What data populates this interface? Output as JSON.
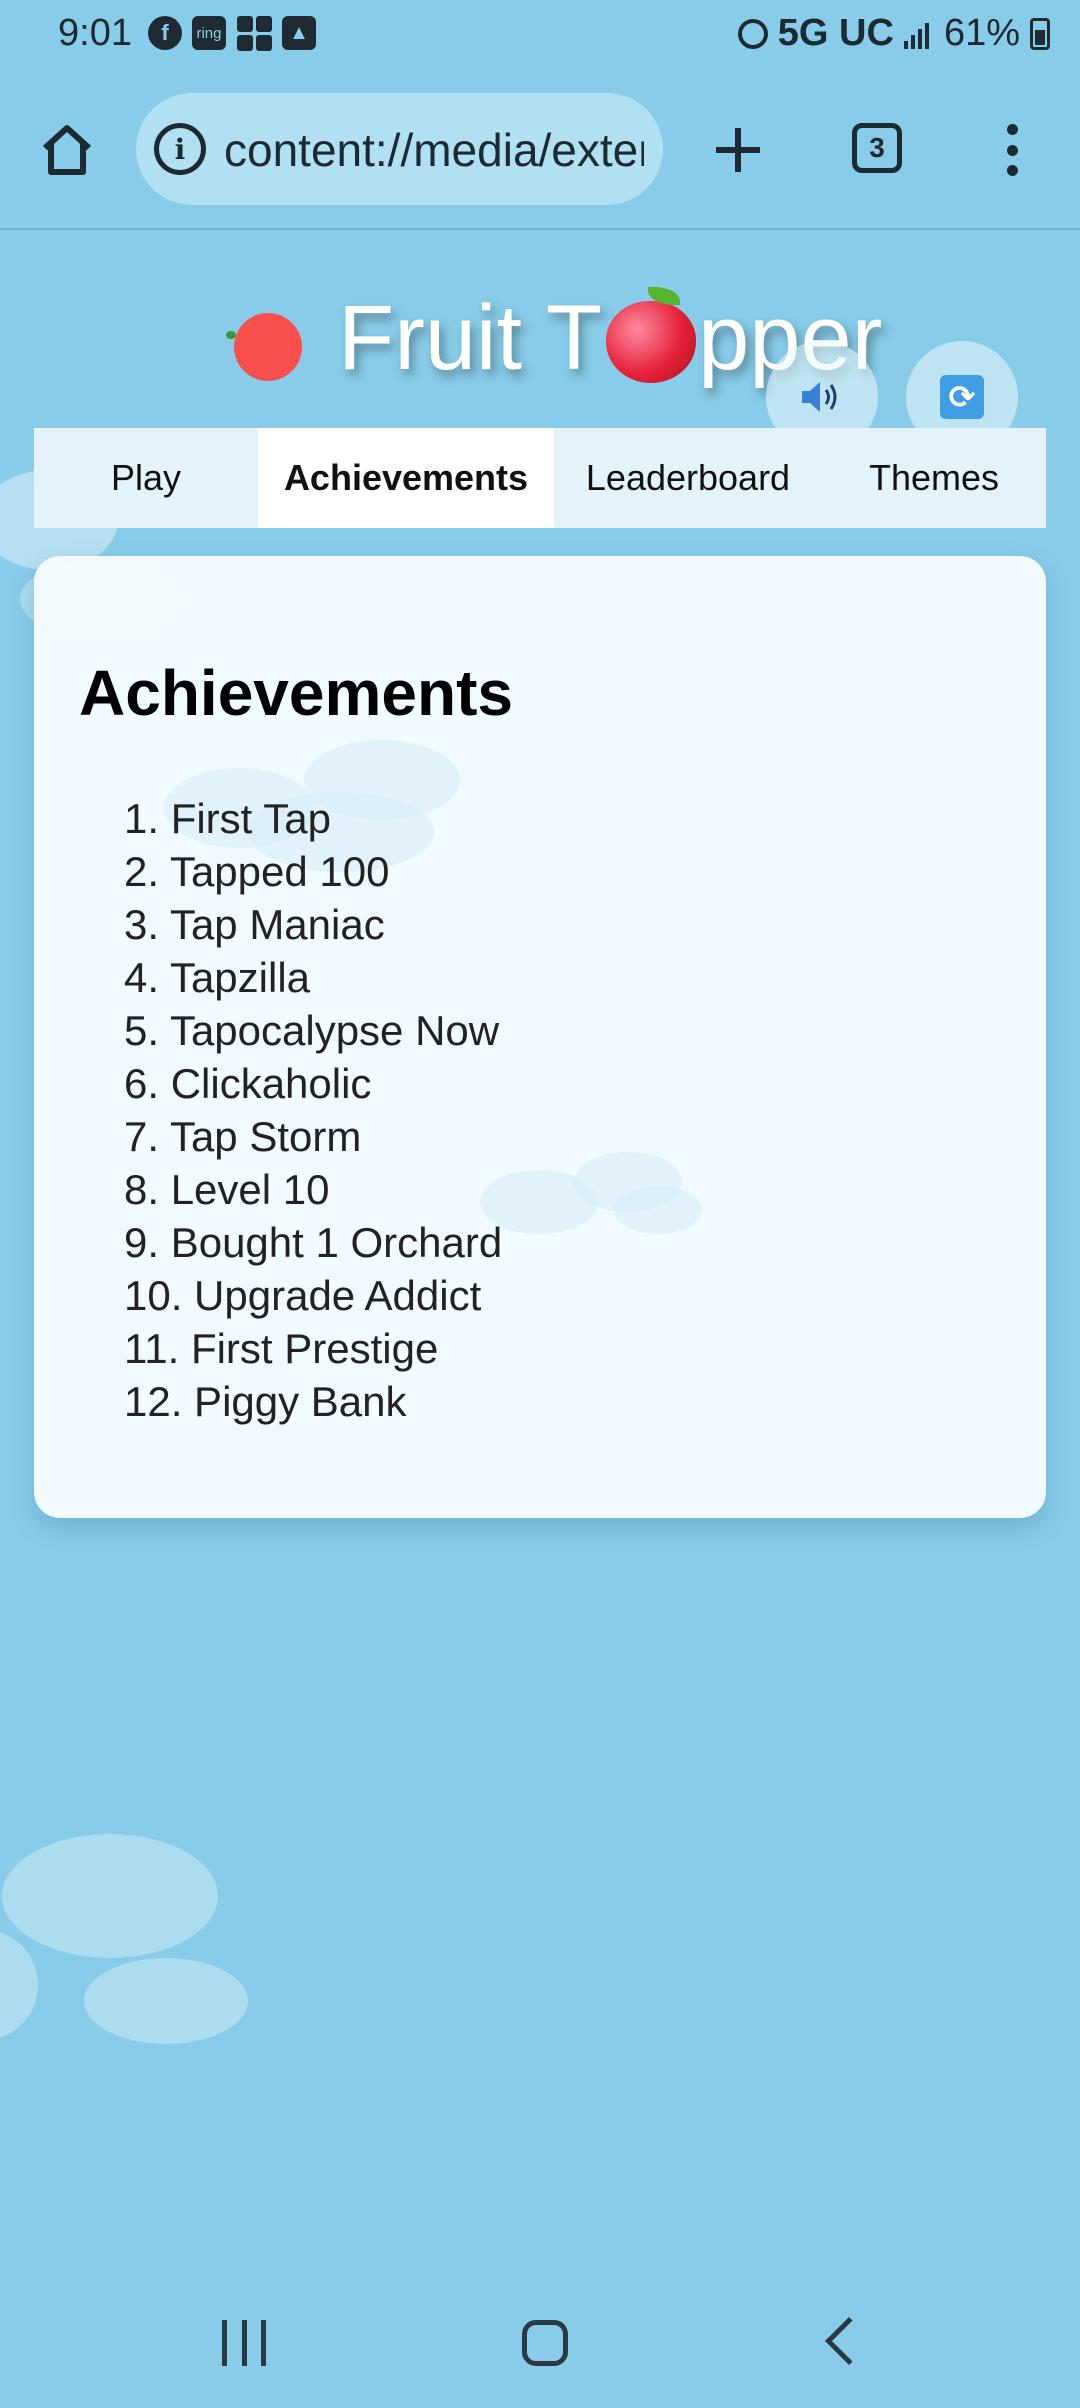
{
  "status_bar": {
    "time": "9:01",
    "app_icons": [
      "facebook-icon",
      "ring-icon",
      "apps-grid-icon",
      "gallery-icon"
    ],
    "ring_label": "ring",
    "network": "5G UC",
    "battery": "61%"
  },
  "browser": {
    "url": "content://media/external",
    "tab_count": "3",
    "icons": [
      "home-icon",
      "info-icon",
      "plus-icon",
      "tabs-icon",
      "more-vert-icon"
    ]
  },
  "game": {
    "title_before": "Fruit T",
    "title_after": "pper",
    "sound_icon": "🔊",
    "refresh_icon": "🔄"
  },
  "tabs": [
    {
      "label": "Play",
      "active": false
    },
    {
      "label": "Achievements",
      "active": true
    },
    {
      "label": "Leaderboard",
      "active": false
    },
    {
      "label": "Themes",
      "active": false
    }
  ],
  "achievements": {
    "heading": "Achievements",
    "items": [
      "1. First Tap",
      "2. Tapped 100",
      "3. Tap Maniac",
      "4. Tapzilla",
      "5. Tapocalypse Now",
      "6. Clickaholic",
      "7. Tap Storm",
      "8. Level 10",
      "9. Bought 1 Orchard",
      "10. Upgrade Addict",
      "11. First Prestige",
      "12. Piggy Bank"
    ]
  },
  "colors": {
    "background": "#88cce9",
    "card": "#f5fbfe",
    "active_tab": "#ffffff",
    "tab_bar": "#e4f2f9",
    "fruit_red": "#fb4f4f"
  }
}
